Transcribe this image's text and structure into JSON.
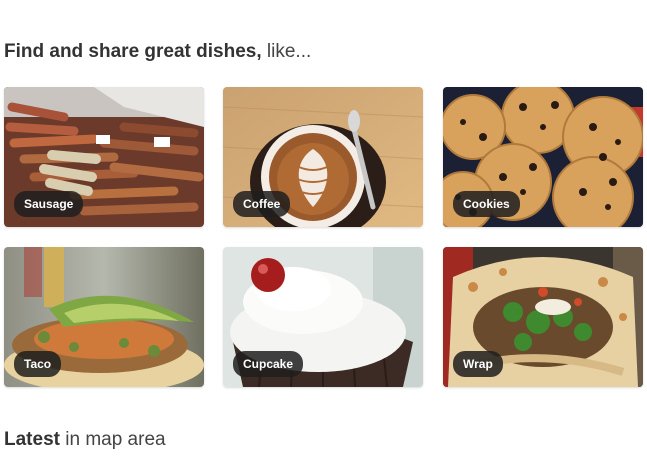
{
  "intro": {
    "bold": "Find and share great dishes,",
    "light": " like..."
  },
  "dishes": [
    {
      "label": "Sausage"
    },
    {
      "label": "Coffee"
    },
    {
      "label": "Cookies"
    },
    {
      "label": "Taco"
    },
    {
      "label": "Cupcake"
    },
    {
      "label": "Wrap"
    }
  ],
  "latest": {
    "bold": "Latest",
    "light": " in map area"
  }
}
